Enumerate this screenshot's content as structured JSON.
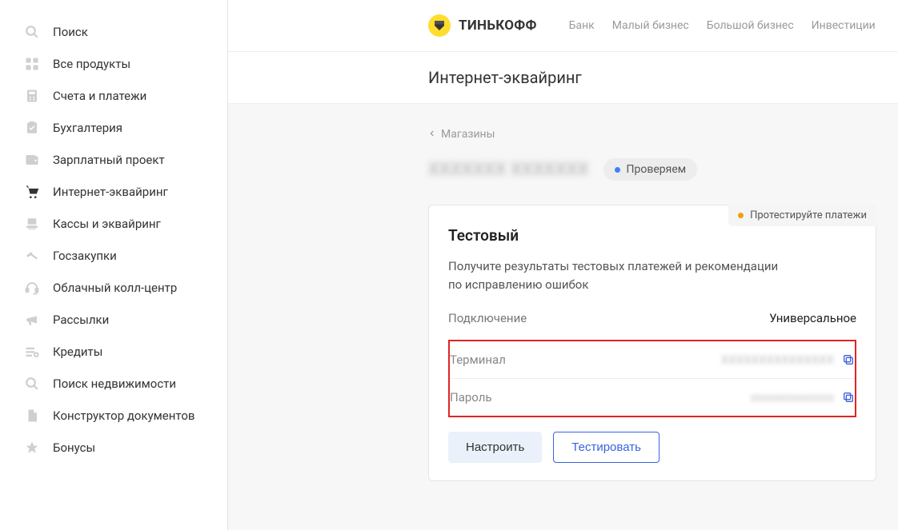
{
  "sidebar": {
    "items": [
      {
        "label": "Поиск",
        "icon": "search-icon",
        "active": false
      },
      {
        "label": "Все продукты",
        "icon": "grid-icon",
        "active": false
      },
      {
        "label": "Счета и платежи",
        "icon": "calculator-icon",
        "active": false
      },
      {
        "label": "Бухгалтерия",
        "icon": "clipboard-icon",
        "active": false
      },
      {
        "label": "Зарплатный проект",
        "icon": "wallet-icon",
        "active": false
      },
      {
        "label": "Интернет-эквайринг",
        "icon": "cart-icon",
        "active": true
      },
      {
        "label": "Кассы и эквайринг",
        "icon": "pos-icon",
        "active": false
      },
      {
        "label": "Госзакупки",
        "icon": "gavel-icon",
        "active": false
      },
      {
        "label": "Облачный колл-центр",
        "icon": "headset-icon",
        "active": false
      },
      {
        "label": "Рассылки",
        "icon": "megaphone-icon",
        "active": false
      },
      {
        "label": "Кредиты",
        "icon": "plus-list-icon",
        "active": false
      },
      {
        "label": "Поиск недвижимости",
        "icon": "search-icon",
        "active": false
      },
      {
        "label": "Конструктор документов",
        "icon": "document-icon",
        "active": false
      },
      {
        "label": "Бонусы",
        "icon": "star-icon",
        "active": false
      }
    ]
  },
  "header": {
    "brand": "ТИНЬКОФФ",
    "nav": [
      "Банк",
      "Малый бизнес",
      "Большой бизнес",
      "Инвестиции"
    ]
  },
  "page": {
    "subtitle": "Интернет-эквайринг",
    "breadcrumb": "Магазины",
    "shop_name_placeholder": "XXXXXXX XXXXXXX",
    "status": "Проверяем"
  },
  "card": {
    "badge": "Протестируйте платежи",
    "title": "Тестовый",
    "desc_l1": "Получите результаты тестовых платежей и рекомендации",
    "desc_l2": "по исправлению ошибок",
    "connection_label": "Подключение",
    "connection_value": "Универсальное",
    "terminal_label": "Терминал",
    "terminal_value_placeholder": "XXXXXXXXXXXXXXX",
    "password_label": "Пароль",
    "password_value_placeholder": "xxxxxxxxxxxxxx",
    "button_configure": "Настроить",
    "button_test": "Тестировать"
  }
}
